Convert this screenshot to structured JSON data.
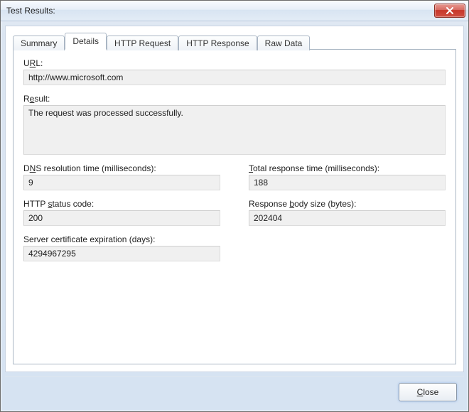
{
  "window": {
    "title": "Test Results:"
  },
  "tabs": {
    "summary": "Summary",
    "details": "Details",
    "http_request": "HTTP Request",
    "http_response": "HTTP Response",
    "raw_data": "Raw Data"
  },
  "labels": {
    "url_pre": "U",
    "url_u": "R",
    "url_post": "L:",
    "result_pre": "R",
    "result_u": "e",
    "result_post": "sult:",
    "dns_pre": "D",
    "dns_u": "N",
    "dns_post": "S resolution time (milliseconds):",
    "total_u": "T",
    "total_post": "otal response time (milliseconds):",
    "status_pre": "HTTP ",
    "status_u": "s",
    "status_post": "tatus code:",
    "body_pre": "Response ",
    "body_u": "b",
    "body_post": "ody size (bytes):",
    "cert_pre": "Server certificate expiration (days):"
  },
  "values": {
    "url": "http://www.microsoft.com",
    "result": "The request was processed successfully.",
    "dns": "9",
    "total": "188",
    "status": "200",
    "body": "202404",
    "cert": "4294967295"
  },
  "buttons": {
    "close_u": "C",
    "close_post": "lose"
  }
}
